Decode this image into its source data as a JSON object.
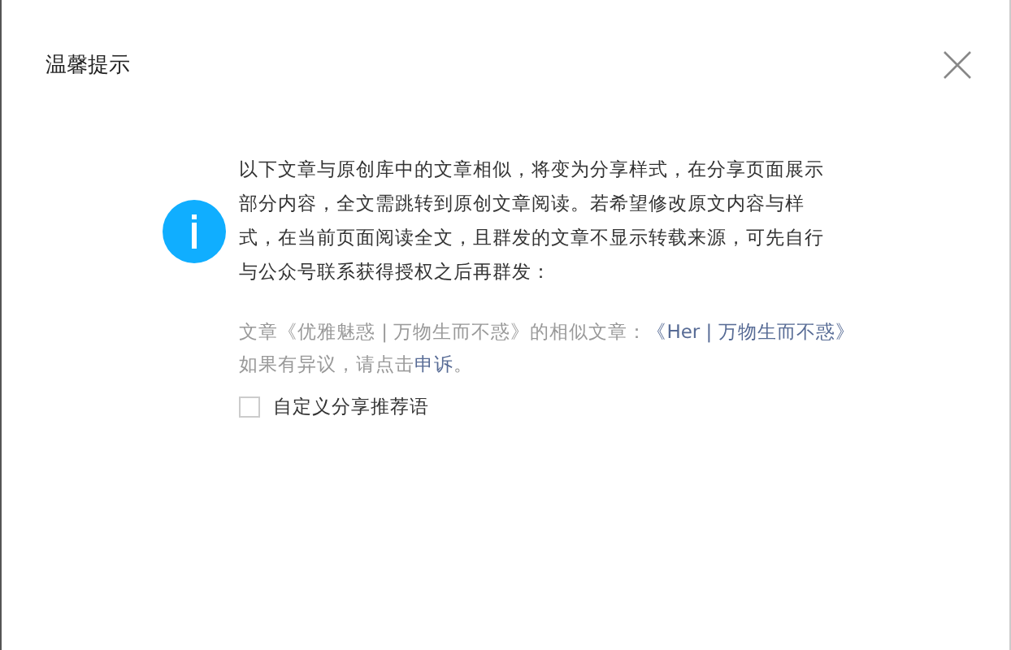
{
  "dialog": {
    "title": "温馨提示"
  },
  "message": "以下文章与原创库中的文章相似，将变为分享样式，在分享页面展示部分内容，全文需跳转到原创文章阅读。若希望修改原文内容与样式，在当前页面阅读全文，且群发的文章不显示转载来源，可先自行与公众号联系获得授权之后再群发：",
  "similar": {
    "text": "文章《优雅魅惑 | 万物生而不惑》的相似文章：",
    "link": "《Her | 万物生而不惑》"
  },
  "appeal": {
    "text": "如果有异议，请点击",
    "link": "申诉",
    "suffix": "。"
  },
  "option": {
    "label": "自定义分享推荐语",
    "checked": false
  }
}
